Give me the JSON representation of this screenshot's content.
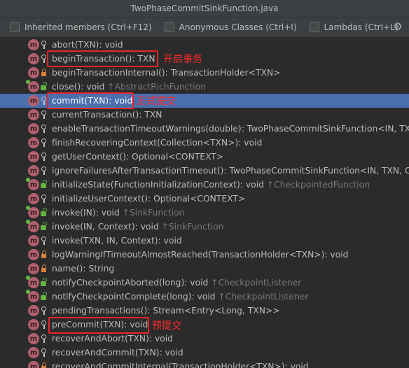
{
  "window": {
    "title": "TwoPhaseCommitSinkFunction.java"
  },
  "options": {
    "inherited": "Inherited members (Ctrl+F12)",
    "anonymous": "Anonymous Classes (Ctrl+I)",
    "lambdas": "Lambdas (Ctrl+L)",
    "settings_icon": "gear-icon"
  },
  "annotations": {
    "begin": "开启事务",
    "commit": "正式提交",
    "precommit": "预提交"
  },
  "members": [
    {
      "name": "abort(TXN): void",
      "from": "",
      "vis": "key"
    },
    {
      "name": "beginTransaction(): TXN",
      "from": "",
      "vis": "key"
    },
    {
      "name": "beginTransactionInternal(): TransactionHolder<TXN>",
      "from": "",
      "vis": "lock"
    },
    {
      "name": "close(): void",
      "from": "↑AbstractRichFunction",
      "vis": "unlock"
    },
    {
      "name": "commit(TXN): void",
      "from": "",
      "vis": "key"
    },
    {
      "name": "currentTransaction(): TXN",
      "from": "",
      "vis": "key"
    },
    {
      "name": "enableTransactionTimeoutWarnings(double): TwoPhaseCommitSinkFunction<IN, TXN, C",
      "from": "",
      "vis": "key"
    },
    {
      "name": "finishRecoveringContext(Collection<TXN>): void",
      "from": "",
      "vis": "key"
    },
    {
      "name": "getUserContext(): Optional<CONTEXT>",
      "from": "",
      "vis": "key"
    },
    {
      "name": "ignoreFailuresAfterTransactionTimeout(): TwoPhaseCommitSinkFunction<IN, TXN, CONT",
      "from": "",
      "vis": "key"
    },
    {
      "name": "initializeState(FunctionInitializationContext): void",
      "from": "↑CheckpointedFunction",
      "vis": "unlock"
    },
    {
      "name": "initializeUserContext(): Optional<CONTEXT>",
      "from": "",
      "vis": "key"
    },
    {
      "name": "invoke(IN): void",
      "from": "↑SinkFunction",
      "vis": "unlock"
    },
    {
      "name": "invoke(IN, Context): void",
      "from": "↑SinkFunction",
      "vis": "unlock"
    },
    {
      "name": "invoke(TXN, IN, Context): void",
      "from": "",
      "vis": "key"
    },
    {
      "name": "logWarningIfTimeoutAlmostReached(TransactionHolder<TXN>): void",
      "from": "",
      "vis": "lock"
    },
    {
      "name": "name(): String",
      "from": "",
      "vis": "lock"
    },
    {
      "name": "notifyCheckpointAborted(long): void",
      "from": "↑CheckpointListener",
      "vis": "unlock"
    },
    {
      "name": "notifyCheckpointComplete(long): void",
      "from": "↑CheckpointListener",
      "vis": "unlock"
    },
    {
      "name": "pendingTransactions(): Stream<Entry<Long, TXN>>",
      "from": "",
      "vis": "key"
    },
    {
      "name": "preCommit(TXN): void",
      "from": "",
      "vis": "key"
    },
    {
      "name": "recoverAndAbort(TXN): void",
      "from": "",
      "vis": "key"
    },
    {
      "name": "recoverAndCommit(TXN): void",
      "from": "",
      "vis": "key"
    },
    {
      "name": "recoverAndCommitInternal(TransactionHolder<TXN>): void",
      "from": "",
      "vis": "lock"
    }
  ],
  "selected_index": 4,
  "method_icon_letter": "m",
  "colors": {
    "accent": "#4b6eaf",
    "highlight": "#e8262a",
    "method_icon": "#b0606e"
  }
}
